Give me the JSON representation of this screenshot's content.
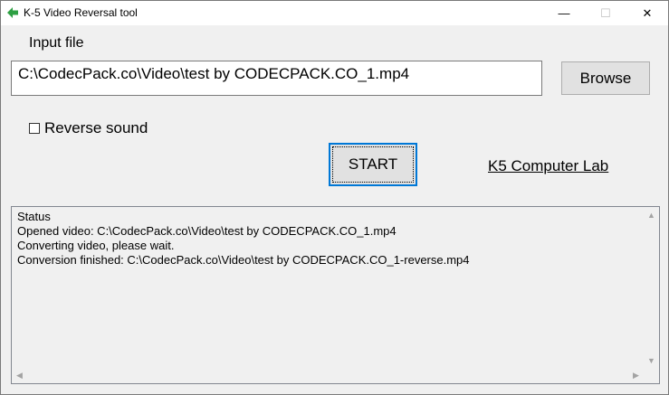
{
  "window": {
    "title": "K-5 Video Reversal tool",
    "minimize_glyph": "—",
    "maximize_glyph": "☐",
    "close_glyph": "✕"
  },
  "input": {
    "label": "Input file",
    "value": "C:\\CodecPack.co\\Video\\test by CODECPACK.CO_1.mp4",
    "browse_label": "Browse"
  },
  "options": {
    "reverse_sound_label": "Reverse sound",
    "reverse_sound_checked": false
  },
  "actions": {
    "start_label": "START",
    "lab_link": "K5 Computer Lab"
  },
  "status": {
    "lines": [
      "Status",
      "Opened video: C:\\CodecPack.co\\Video\\test by CODECPACK.CO_1.mp4",
      "Converting video, please wait.",
      "Conversion finished: C:\\CodecPack.co\\Video\\test by CODECPACK.CO_1-reverse.mp4"
    ]
  },
  "icons": {
    "app": "green-back-arrow-icon",
    "scroll_up": "scroll-up-arrow-icon",
    "scroll_down": "scroll-down-arrow-icon",
    "scroll_left": "scroll-left-arrow-icon",
    "scroll_right": "scroll-right-arrow-icon"
  },
  "colors": {
    "app_icon": "#2ea043",
    "focus_border": "#0078d7"
  }
}
